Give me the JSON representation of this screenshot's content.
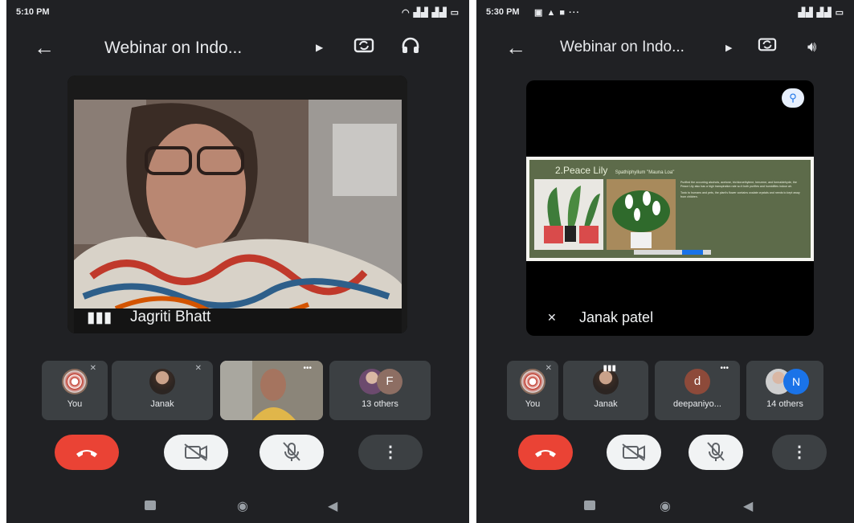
{
  "left": {
    "status_time": "5:10 PM",
    "meeting_title": "Webinar on Indo...",
    "speaker_name": "Jagriti Bhatt",
    "participants": [
      {
        "label": "You"
      },
      {
        "label": "Janak"
      },
      {
        "label": ""
      },
      {
        "label": "13 others",
        "badge": "F"
      }
    ]
  },
  "right": {
    "status_time": "5:30 PM",
    "meeting_title": "Webinar on Indo...",
    "speaker_name": "Janak patel",
    "slide": {
      "heading": "2.Peace Lily",
      "subheading": "Spathiphyllum \"Mauna Loa\"",
      "bullets": [
        "Purified the occurring alcohols, acetone, trichloroethylene, benzene, and formaldehyde, the Peace Lily also has a high transpiration rate so it both purifies and humidifies indoor air.",
        "Toxic to humans and pets, the plant's flower contains oxalate crystals and needs to kept away from children."
      ]
    },
    "participants": [
      {
        "label": "You"
      },
      {
        "label": "Janak"
      },
      {
        "label": "deepaniyo...",
        "badge": "d"
      },
      {
        "label": "14 others",
        "badge": "N"
      }
    ]
  },
  "colors": {
    "background": "#202124",
    "tile": "#3c4043",
    "end_call": "#ea4335",
    "button_light": "#f1f3f4",
    "slide_bg": "#5d6b4a",
    "accent_blue": "#1a73e8"
  }
}
